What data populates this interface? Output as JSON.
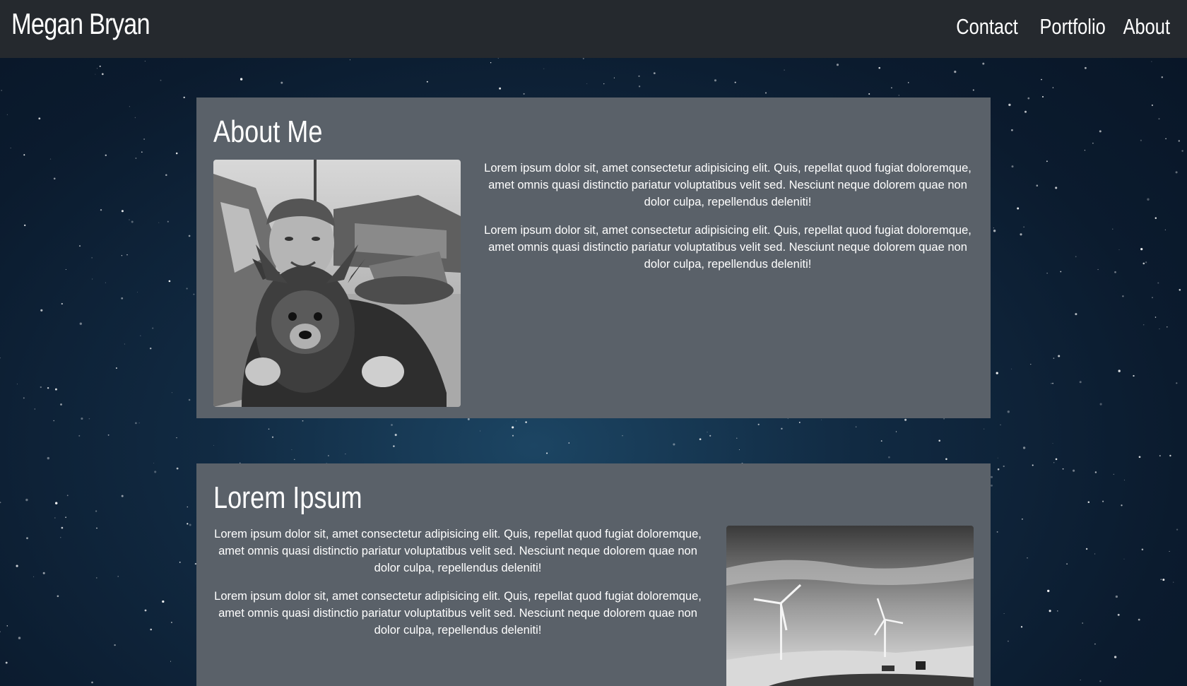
{
  "brand": "Megan Bryan",
  "nav": {
    "contact": "Contact",
    "portfolio": "Portfolio",
    "about": "About"
  },
  "about_section": {
    "title": "About Me",
    "paragraphs": [
      "Lorem ipsum dolor sit, amet consectetur adipisicing elit. Quis, repellat quod fugiat doloremque, amet omnis quasi distinctio pariatur voluptatibus velit sed. Nesciunt neque dolorem quae non dolor culpa, repellendus deleniti!",
      "Lorem ipsum dolor sit, amet consectetur adipisicing elit. Quis, repellat quod fugiat doloremque, amet omnis quasi distinctio pariatur voluptatibus velit sed. Nesciunt neque dolorem quae non dolor culpa, repellendus deleniti!"
    ]
  },
  "lorem_section": {
    "title": "Lorem Ipsum",
    "paragraphs": [
      "Lorem ipsum dolor sit, amet consectetur adipisicing elit. Quis, repellat quod fugiat doloremque, amet omnis quasi distinctio pariatur voluptatibus velit sed. Nesciunt neque dolorem quae non dolor culpa, repellendus deleniti!",
      "Lorem ipsum dolor sit, amet consectetur adipisicing elit. Quis, repellat quod fugiat doloremque, amet omnis quasi distinctio pariatur voluptatibus velit sed. Nesciunt neque dolorem quae non dolor culpa, repellendus deleniti!"
    ]
  },
  "colors": {
    "navbar": "#25292e",
    "section_bg": "#5a6169",
    "text": "#ffffff"
  }
}
